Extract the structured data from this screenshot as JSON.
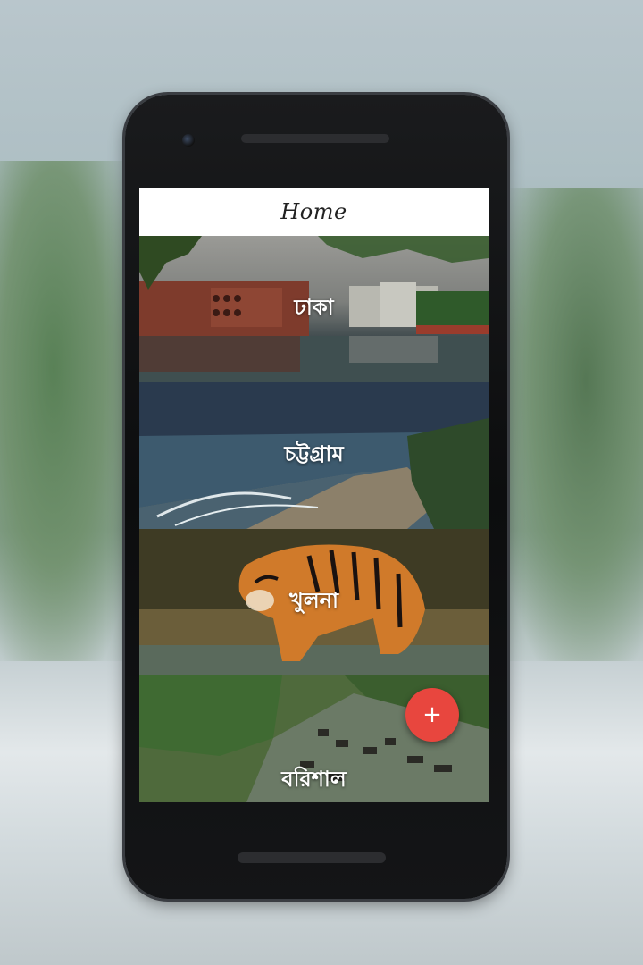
{
  "app": {
    "title": "Home"
  },
  "divisions": [
    {
      "label": "ঢাকা"
    },
    {
      "label": "চট্টগ্রাম"
    },
    {
      "label": "খুলনা"
    },
    {
      "label": "বরিশাল"
    }
  ],
  "fab": {
    "icon": "plus-icon",
    "label": "+",
    "color": "#e8463e"
  },
  "navigation": {
    "back_icon": "back-triangle-icon",
    "home_icon": "home-circle-icon",
    "recents_icon": "recents-square-icon"
  }
}
